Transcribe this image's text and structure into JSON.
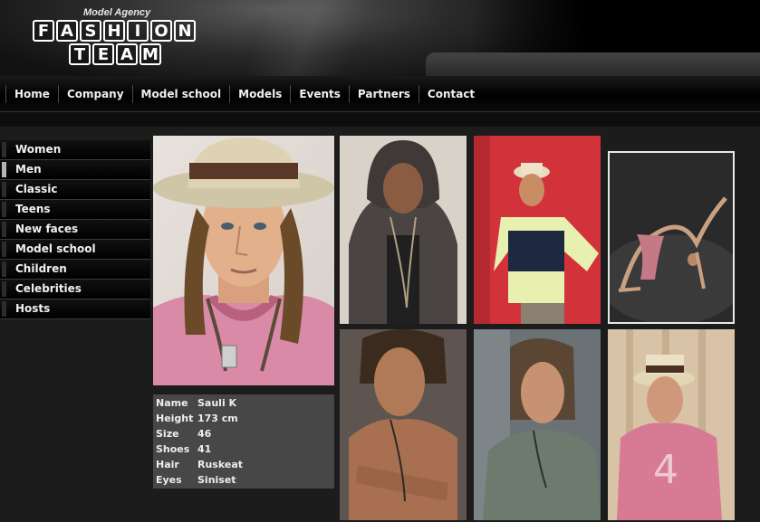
{
  "logo": {
    "tagline": "Model Agency",
    "line1": [
      "F",
      "A",
      "S",
      "H",
      "I",
      "O",
      "N"
    ],
    "line2": [
      "T",
      "E",
      "A",
      "M"
    ]
  },
  "nav": {
    "items": [
      "Home",
      "Company",
      "Model school",
      "Models",
      "Events",
      "Partners",
      "Contact"
    ]
  },
  "sidebar": {
    "items": [
      {
        "label": "Women",
        "active": false
      },
      {
        "label": "Men",
        "active": true
      },
      {
        "label": "Classic",
        "active": false
      },
      {
        "label": "Teens",
        "active": false
      },
      {
        "label": "New faces",
        "active": false
      },
      {
        "label": "Model school",
        "active": false
      },
      {
        "label": "Children",
        "active": false
      },
      {
        "label": "Celebrities",
        "active": false
      },
      {
        "label": "Hosts",
        "active": false
      }
    ]
  },
  "model_info": {
    "rows": [
      {
        "key": "Name",
        "value": "Sauli K"
      },
      {
        "key": "Height",
        "value": "173 cm"
      },
      {
        "key": "Size",
        "value": "46"
      },
      {
        "key": "Shoes",
        "value": "41"
      },
      {
        "key": "Hair",
        "value": "Ruskeat"
      },
      {
        "key": "Eyes",
        "value": "Siniset"
      }
    ]
  },
  "colors": {
    "background": "#1c1c1c",
    "info_panel": "#474747",
    "active_accent": "#b5b5b5"
  }
}
